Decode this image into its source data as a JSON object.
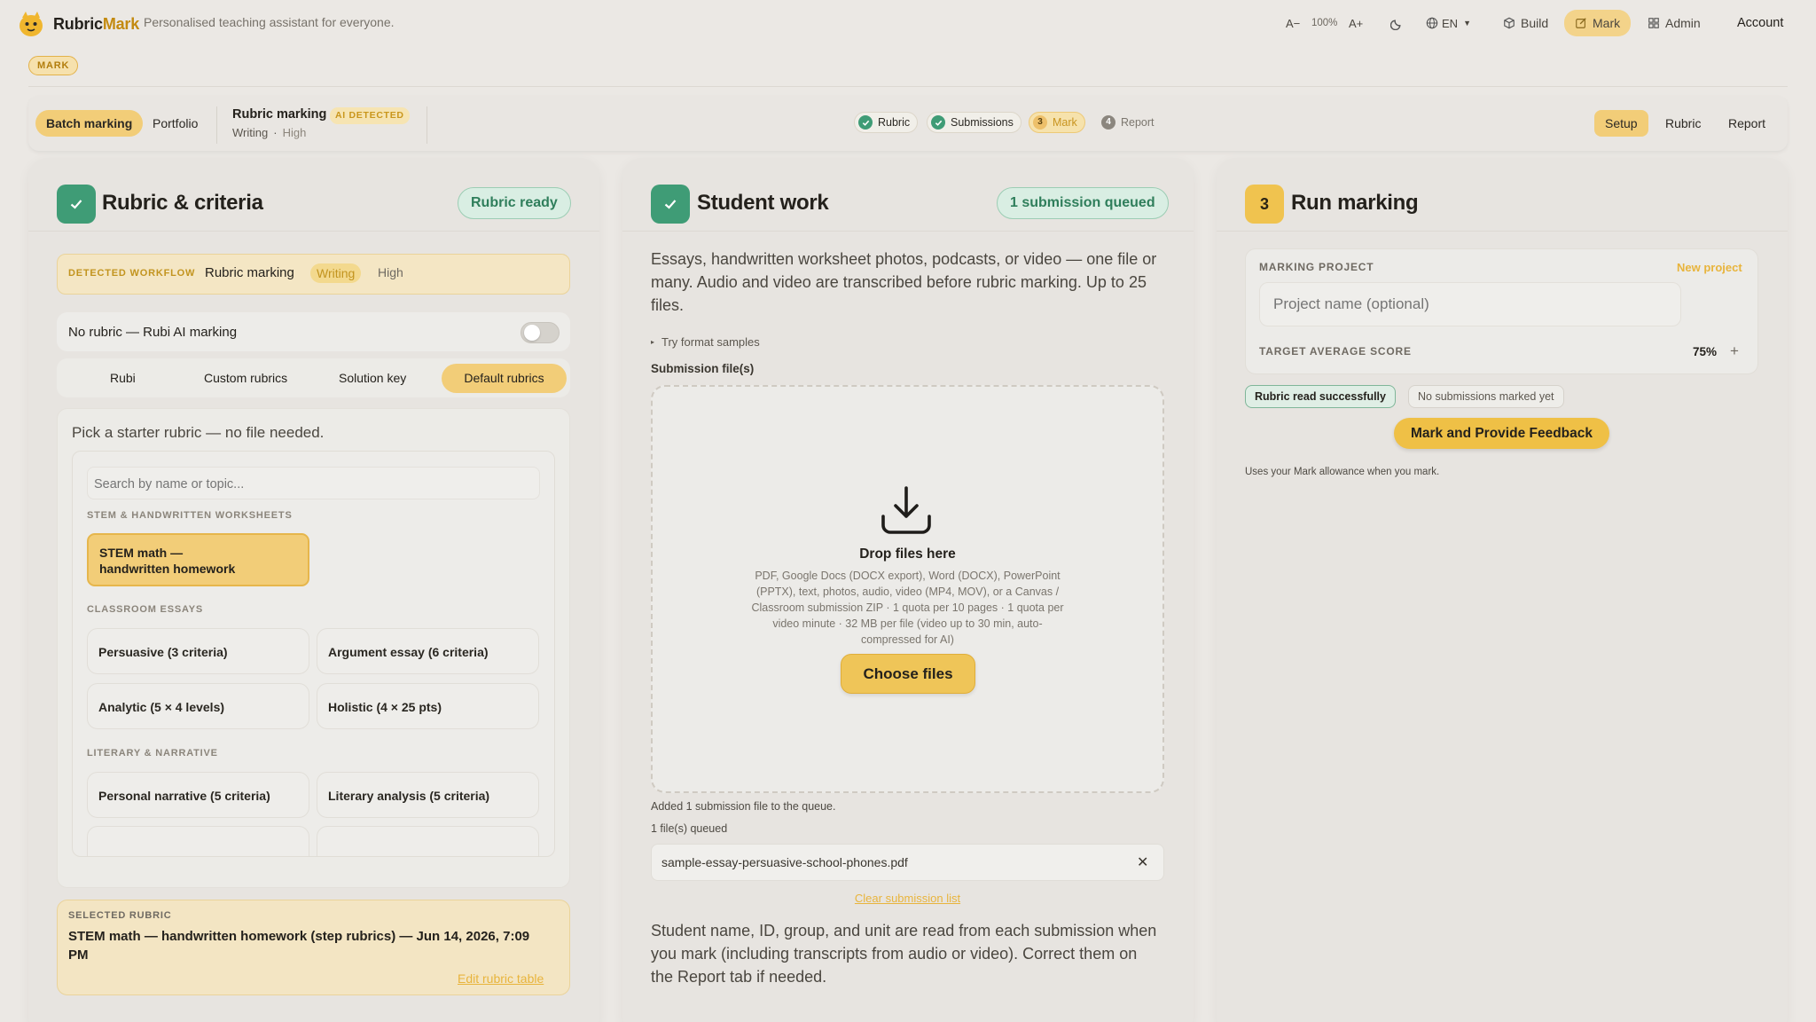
{
  "header": {
    "brand_part1": "Rubric",
    "brand_part2": "Mark",
    "tagline": "Personalised teaching assistant for everyone.",
    "font_decrease": "A−",
    "zoom": "100%",
    "font_increase": "A+",
    "language": "EN",
    "nav_build": "Build",
    "nav_mark": "Mark",
    "nav_admin": "Admin",
    "account": "Account"
  },
  "mode_badge": "MARK",
  "subnav": {
    "batch_marking": "Batch marking",
    "portfolio": "Portfolio",
    "workflow_title": "Rubric marking",
    "ai_detected": "AI DETECTED",
    "workflow_subject": "Writing",
    "workflow_level": "High",
    "steps": [
      {
        "label": "Rubric",
        "state": "done"
      },
      {
        "label": "Submissions",
        "state": "done"
      },
      {
        "num": "3",
        "label": "Mark",
        "state": "current"
      },
      {
        "num": "4",
        "label": "Report",
        "state": "todo"
      }
    ],
    "tabs": {
      "setup": "Setup",
      "rubric": "Rubric",
      "report": "Report"
    }
  },
  "rubric_panel": {
    "title": "Rubric & criteria",
    "status": "Rubric ready",
    "detected_label": "DETECTED WORKFLOW",
    "detected_name": "Rubric marking",
    "detected_subject": "Writing",
    "detected_level": "High",
    "no_rubric_label": "No rubric — Rubi AI marking",
    "tabs": [
      "Rubi",
      "Custom rubrics",
      "Solution key",
      "Default rubrics"
    ],
    "starter_text": "Pick a starter rubric — no file needed.",
    "search_placeholder": "Search by name or topic...",
    "group1": "STEM & HANDWRITTEN WORKSHEETS",
    "stem_line1": "STEM math —",
    "stem_line2": "handwritten homework",
    "group2": "CLASSROOM ESSAYS",
    "essays": [
      "Persuasive (3 criteria)",
      "Argument essay (6 criteria)",
      "Analytic (5 × 4 levels)",
      "Holistic (4 × 25 pts)"
    ],
    "group3": "LITERARY & NARRATIVE",
    "literary": [
      "Personal narrative (5 criteria)",
      "Literary analysis (5 criteria)"
    ],
    "selected_label": "SELECTED RUBRIC",
    "selected_line1": "STEM math — handwritten homework (step rubrics) — Jun 14, 2026, 7:09",
    "selected_line2": "PM",
    "edit_link": "Edit rubric table"
  },
  "student_panel": {
    "title": "Student work",
    "status": "1 submission queued",
    "desc_line1": "Essays, handwritten worksheet photos, podcasts, or video — one file or",
    "desc_line2": "many. Audio and video are transcribed before rubric marking. Up to 25",
    "desc_line3": "files.",
    "format_samples": "Try format samples",
    "files_label": "Submission file(s)",
    "drop_title": "Drop files here",
    "drop_l1": "PDF, Google Docs (DOCX export), Word (DOCX), PowerPoint",
    "drop_l2": "(PPTX), text, photos, audio, video (MP4, MOV), or a Canvas /",
    "drop_l3": "Classroom submission ZIP · 1 quota per 10 pages · 1 quota per",
    "drop_l4": "video minute · 32 MB per file (video up to 30 min, auto-",
    "drop_l5": "compressed for AI)",
    "choose_files": "Choose files",
    "added_msg": "Added 1 submission file to the queue.",
    "queued_count": "1 file(s) queued",
    "file_name": "sample-essay-persuasive-school-phones.pdf",
    "clear_list": "Clear submission list",
    "note_l1": "Student name, ID, group, and unit are read from each submission when",
    "note_l2": "you mark (including transcripts from audio or video). Correct them on",
    "note_l3": "the Report tab if needed."
  },
  "run_panel": {
    "step_num": "3",
    "title": "Run marking",
    "project_label": "MARKING PROJECT",
    "new_project": "New project",
    "project_placeholder": "Project name (optional)",
    "target_label": "TARGET AVERAGE SCORE",
    "target_value": "75%",
    "tag_read": "Rubric read successfully",
    "tag_none": "No submissions marked yet",
    "mark_button": "Mark and Provide Feedback",
    "allowance_note": "Uses your Mark allowance when you mark."
  }
}
